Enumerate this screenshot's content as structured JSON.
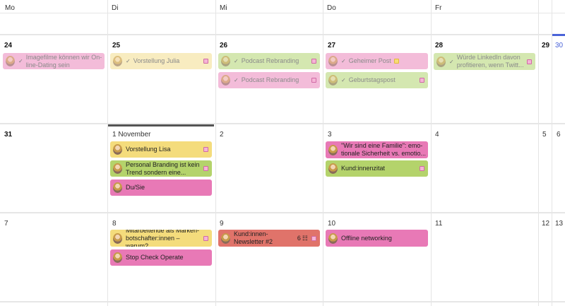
{
  "weekdays": [
    "Mo",
    "Di",
    "Mi",
    "Do",
    "Fr"
  ],
  "weeks": [
    {
      "days": [
        "24",
        "25",
        "26",
        "27",
        "28",
        "29",
        "30"
      ],
      "events": [
        {
          "title": "Imagefilme können wir On-line-Dating sein",
          "done": true,
          "color": "#f3bcd9"
        },
        {
          "title": "Vorstellung Julia",
          "done": true,
          "color": "#f8ecc0"
        },
        {
          "title": "Podcast Rebranding",
          "done": true,
          "color": "#d4e7b0"
        },
        {
          "title": "Podcast Rebranding",
          "done": true,
          "color": "#f3bcd9"
        },
        {
          "title": "Geheimer Post",
          "done": true,
          "color": "#f3bcd9"
        },
        {
          "title": "Geburtstagspost",
          "done": true,
          "color": "#d4e7b0"
        },
        {
          "title": "Würde LinkedIn davon profitieren, wenn Twitt...",
          "done": true,
          "color": "#d4e7b0"
        }
      ]
    },
    {
      "days": [
        "31",
        "1 November",
        "2",
        "3",
        "4",
        "5",
        "6"
      ],
      "events": [
        {
          "title": "Vorstellung Lisa",
          "done": false,
          "color": "#f4dc7c"
        },
        {
          "title": "Personal Branding ist kein Trend sondern eine...",
          "done": false,
          "color": "#b4d36b"
        },
        {
          "title": "Du/Sie",
          "done": false,
          "color": "#e879b6"
        },
        {
          "title": "\"Wir sind eine Familie\": emo-tionale Sicherheit vs. emotio...",
          "done": false,
          "color": "#e879b6"
        },
        {
          "title": "Kund:innenzitat",
          "done": false,
          "color": "#b4d36b"
        }
      ]
    },
    {
      "days": [
        "7",
        "8",
        "9",
        "10",
        "11",
        "12",
        "13"
      ],
      "events": [
        {
          "title": "Mitarbeitende als Marken-botschafter:innen – warum?",
          "done": false,
          "color": "#f4dc7c"
        },
        {
          "title": "Stop Check Operate",
          "done": false,
          "color": "#e879b6"
        },
        {
          "title": "Kund:innen-Newsletter #2",
          "count": "6",
          "done": false,
          "color": "#e0736a"
        },
        {
          "title": "Offline networking",
          "done": false,
          "color": "#e879b6"
        }
      ]
    }
  ]
}
